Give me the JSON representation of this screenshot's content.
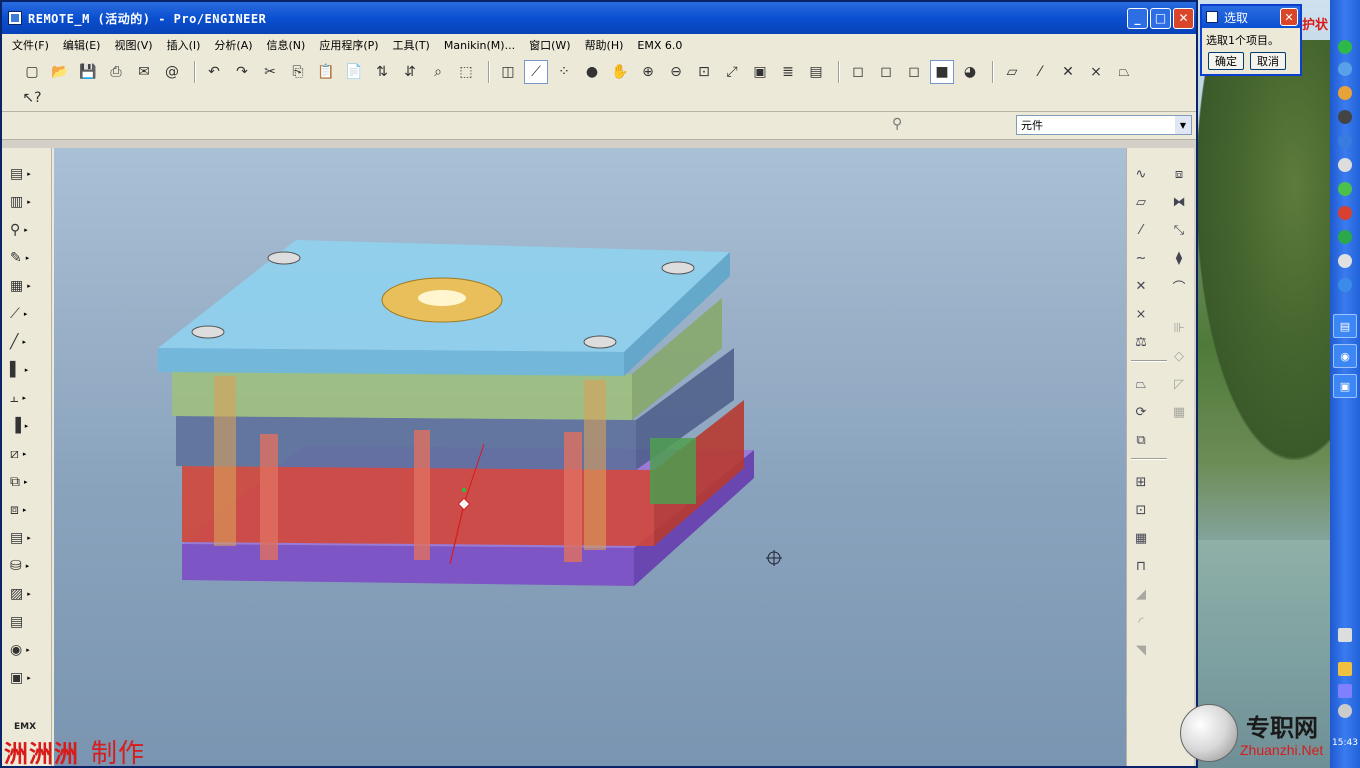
{
  "window": {
    "title": "REMOTE_M (活动的) - Pro/ENGINEER",
    "controls": [
      "_",
      "□",
      "✕"
    ]
  },
  "menu": [
    "文件(F)",
    "编辑(E)",
    "视图(V)",
    "插入(I)",
    "分析(A)",
    "信息(N)",
    "应用程序(P)",
    "工具(T)",
    "Manikin(M)...",
    "窗口(W)",
    "帮助(H)",
    "EMX 6.0"
  ],
  "toolbar": {
    "row1": [
      "new-file-icon",
      "open-icon",
      "save-icon",
      "print-icon",
      "email-icon",
      "email-link-icon",
      "undo-icon",
      "redo-icon",
      "cut-icon",
      "copy-icon",
      "paste-icon",
      "paste-special-icon",
      "regenerate-icon",
      "regen-manager-icon",
      "find-icon",
      "select-box-icon",
      "datum-display-icon",
      "axis-display-icon",
      "point-display-icon",
      "shading-icon",
      "pan-icon",
      "zoom-in-icon",
      "zoom-out-icon",
      "refit-icon",
      "reorient-icon",
      "saved-views-icon",
      "layers-icon",
      "view-manager-icon",
      "wireframe-icon",
      "hidden-line-icon",
      "no-hidden-icon",
      "shaded-icon",
      "enhanced-realism-icon",
      "datum-plane-tool-icon",
      "datum-axis-tool-icon",
      "datum-point-tool-icon",
      "csys-tool-icon",
      "annotation-icon"
    ],
    "row2": [
      "context-help-icon"
    ]
  },
  "filter": {
    "selected": "元件"
  },
  "left_toolbar": [
    "mold-base-icon",
    "plate-icon",
    "screw-icon",
    "pin-icon",
    "guide-icon",
    "ejector-icon",
    "rod-icon",
    "slider-icon",
    "lifter-icon",
    "cooling-icon",
    "support-icon",
    "spring-icon",
    "stop-icon",
    "emx-part-icon",
    "bom-icon",
    "drawing-icon",
    "hide-icon",
    "check-icon",
    "emx-icon"
  ],
  "right_toolbar_col1": [
    "sketch-icon",
    "plane-icon",
    "axis-icon",
    "curve-icon",
    "point-icon",
    "csys-icon",
    "analysis-icon",
    "extrude-icon",
    "revolve-icon",
    "sweep-icon",
    "merge-icon",
    "trim-icon",
    "offset-icon",
    "thicken-icon",
    "round-icon",
    "chamfer-icon",
    "draft-icon"
  ],
  "right_toolbar_col2": [
    "pattern-icon",
    "mirror-icon",
    "move-icon",
    "blend-icon",
    "surface-icon",
    "style-icon",
    "shell-icon",
    "rib-icon",
    "hole-icon"
  ],
  "select_dialog": {
    "title": "选取",
    "message": "选取1个项目。",
    "ok": "确定",
    "cancel": "取消"
  },
  "side_tag": "护状",
  "emx_tag": "EMX",
  "watermark": {
    "author": "洲洲洲",
    "suffix": "制作"
  },
  "site": {
    "cn": "专职网",
    "en": "Zhuanzhi.Net"
  },
  "clock": "15:43",
  "colors": {
    "title_bar": "#0a4fd0",
    "top_plate": "#7fc6e6",
    "cavity_plate": "#9fc17a",
    "core_plate": "#5b6d99",
    "ejector_plate": "#c8423a",
    "clamp_plate": "#8a62c8",
    "sprue_ring": "#e8bf5a"
  }
}
